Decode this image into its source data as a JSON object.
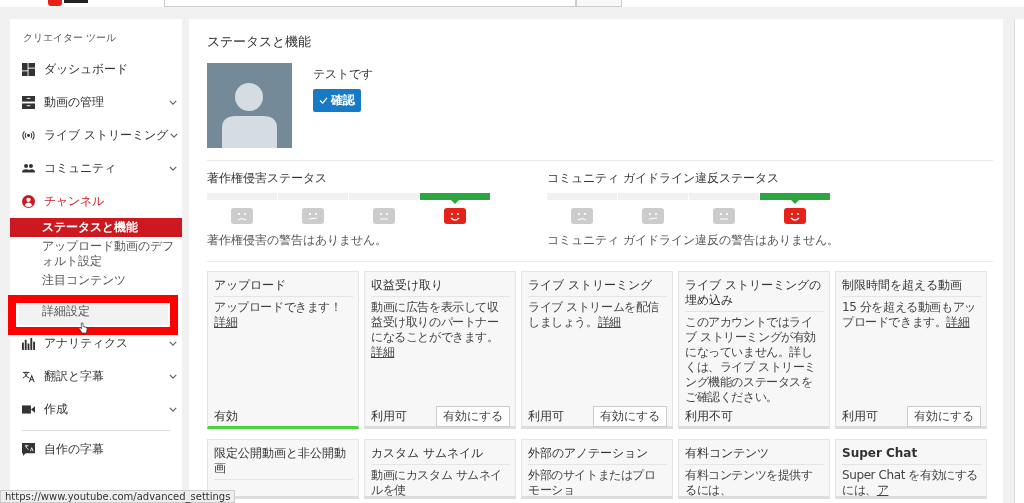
{
  "sidebar": {
    "title": "クリエイター ツール",
    "items": [
      {
        "kind": "dashboard",
        "label": "ダッシュボード",
        "chevron": false,
        "active": false
      },
      {
        "kind": "videos",
        "label": "動画の管理",
        "chevron": true,
        "active": false
      },
      {
        "kind": "live",
        "label": "ライブ ストリーミング",
        "chevron": true,
        "active": false
      },
      {
        "kind": "community",
        "label": "コミュニティ",
        "chevron": true,
        "active": false
      },
      {
        "kind": "channel",
        "label": "チャンネル",
        "chevron": false,
        "active": true,
        "children": [
          {
            "label": "ステータスと機能",
            "selected": true,
            "hovered": false,
            "annotated": false
          },
          {
            "label": "アップロード動画のデフォルト設定",
            "selected": false,
            "hovered": false,
            "annotated": false
          },
          {
            "label": "注目コンテンツ",
            "selected": false,
            "hovered": false,
            "annotated": false
          },
          {
            "label": "詳細設定",
            "selected": false,
            "hovered": true,
            "annotated": true
          }
        ]
      },
      {
        "kind": "analytics",
        "label": "アナリティクス",
        "chevron": true,
        "active": false
      },
      {
        "kind": "translate",
        "label": "翻訳と字幕",
        "chevron": true,
        "active": false
      },
      {
        "kind": "create",
        "label": "作成",
        "chevron": true,
        "active": false
      }
    ],
    "footer_items": [
      {
        "kind": "subtitles",
        "label": "自作の字幕"
      }
    ]
  },
  "main": {
    "title": "ステータスと機能",
    "channel_name": "テストです",
    "verify_button": "確認",
    "statuses": [
      {
        "title": "著作権侵害ステータス",
        "note": "著作権侵害の警告はありません。",
        "segments": [
          {
            "kind": "sad",
            "selected": false
          },
          {
            "kind": "meh",
            "selected": false
          },
          {
            "kind": "neutral",
            "selected": false
          },
          {
            "kind": "happy",
            "selected": true
          }
        ]
      },
      {
        "title": "コミュニティ ガイドライン違反ステータス",
        "note": "コミュニティ ガイドライン違反の警告はありません。",
        "segments": [
          {
            "kind": "sad",
            "selected": false
          },
          {
            "kind": "meh",
            "selected": false
          },
          {
            "kind": "neutral",
            "selected": false
          },
          {
            "kind": "happy",
            "selected": true
          }
        ]
      }
    ],
    "features": [
      {
        "title": "アップロード",
        "text": "アップロードできます！",
        "link": "詳細",
        "status": "有効",
        "enabled": true
      },
      {
        "title": "収益受け取り",
        "text": "動画に広告を表示して収益受け取りのパートナーになることができます。",
        "link": "詳細",
        "status": "利用可",
        "button": "有効にする",
        "enabled": false
      },
      {
        "title": "ライブ ストリーミング",
        "text": "ライブ ストリームを配信しましょう。",
        "link": "詳細",
        "status": "利用可",
        "button": "有効にする",
        "enabled": false
      },
      {
        "title": "ライブ ストリーミングの埋め込み",
        "text": "このアカウントではライブ ストリーミングが有効になっていません。詳しくは、ライブ ストリーミング機能のステータスをご確認ください。",
        "status": "利用不可",
        "enabled": false
      },
      {
        "title": "制限時間を超える動画",
        "text": "15 分を超える動画もアップロードできます。",
        "link": "詳細",
        "status": "利用可",
        "button": "有効にする",
        "enabled": false
      }
    ],
    "more_features": [
      {
        "title": "限定公開動画と非公開動画",
        "bold": false
      },
      {
        "title": "カスタム サムネイル",
        "text": "動画にカスタム サムネイルを使",
        "bold": false
      },
      {
        "title": "外部のアノテーション",
        "text": "外部のサイトまたはプロモーショ",
        "bold": false
      },
      {
        "title": "有料コンテンツ",
        "text": "有料コンテンツを提供するには、",
        "bold": false
      },
      {
        "title": "Super Chat",
        "text": "Super Chat を有効にするには、",
        "link": "ア",
        "bold": true
      }
    ]
  },
  "status_bar": {
    "url": "https://www.youtube.com/advanced_settings"
  }
}
